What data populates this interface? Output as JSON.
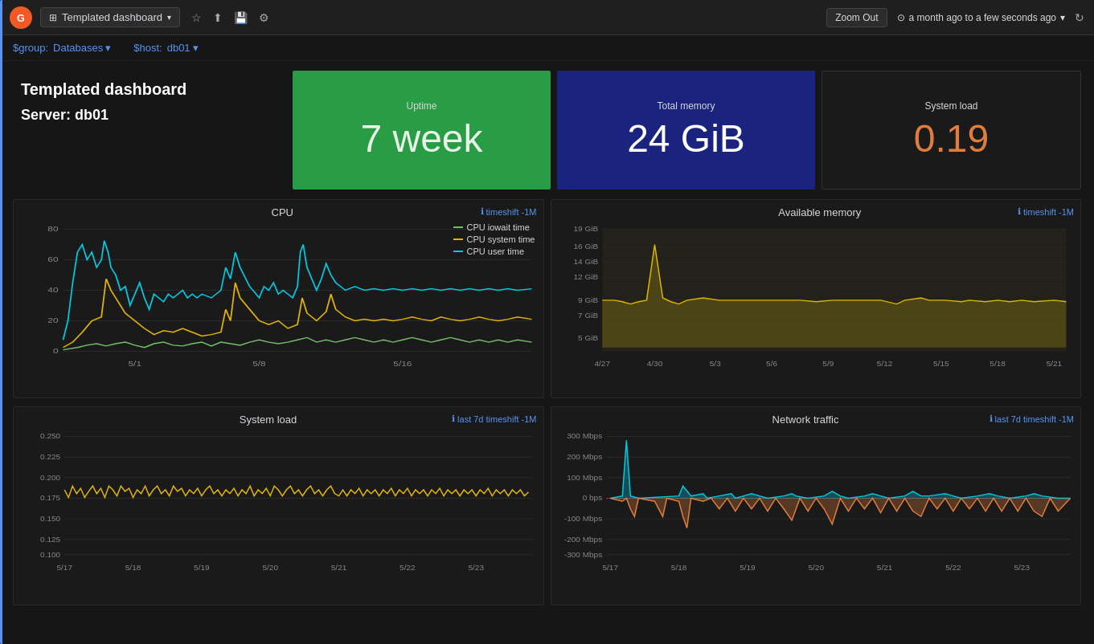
{
  "topbar": {
    "logo_letter": "G",
    "dashboard_label": "Templated dashboard",
    "zoom_out": "Zoom Out",
    "time_range": "a month ago to a few seconds ago",
    "clock_icon": "⊙",
    "refresh_icon": "↻",
    "star_icon": "★",
    "share_icon": "⬆",
    "save_icon": "💾",
    "settings_icon": "⚙"
  },
  "filterbar": {
    "group_label": "$group:",
    "group_value": "Databases",
    "host_label": "$host:",
    "host_value": "db01"
  },
  "title": {
    "dashboard_name": "Templated dashboard",
    "server_name": "Server: db01"
  },
  "uptime": {
    "label": "Uptime",
    "value": "7 week"
  },
  "memory": {
    "label": "Total memory",
    "value": "24 GiB"
  },
  "sysload": {
    "label": "System load",
    "value": "0.19"
  },
  "cpu_chart": {
    "title": "CPU",
    "timeshift": "timeshift -1M",
    "legend": [
      {
        "label": "CPU iowait time",
        "color": "#73bf69"
      },
      {
        "label": "CPU system time",
        "color": "#e0b400"
      },
      {
        "label": "CPU user time",
        "color": "#00c8e0"
      }
    ],
    "y_labels": [
      "80",
      "60",
      "40",
      "20",
      "0"
    ],
    "x_labels": [
      "5/1",
      "5/8",
      "5/16"
    ]
  },
  "memory_chart": {
    "title": "Available memory",
    "timeshift": "timeshift -1M",
    "y_labels": [
      "19 GiB",
      "16 GiB",
      "14 GiB",
      "12 GiB",
      "9 GiB",
      "7 GiB",
      "5 GiB"
    ],
    "x_labels": [
      "4/27",
      "4/30",
      "5/3",
      "5/6",
      "5/9",
      "5/12",
      "5/15",
      "5/18",
      "5/21"
    ]
  },
  "sysload_chart": {
    "title": "System load",
    "timeshift": "last 7d timeshift -1M",
    "y_labels": [
      "0.250",
      "0.225",
      "0.200",
      "0.175",
      "0.150",
      "0.125",
      "0.100"
    ],
    "x_labels": [
      "5/17",
      "5/18",
      "5/19",
      "5/20",
      "5/21",
      "5/22",
      "5/23"
    ]
  },
  "network_chart": {
    "title": "Network traffic",
    "timeshift": "last 7d timeshift -1M",
    "y_labels": [
      "300 Mbps",
      "200 Mbps",
      "100 Mbps",
      "0 bps",
      "-100 Mbps",
      "-200 Mbps",
      "-300 Mbps"
    ],
    "x_labels": [
      "5/17",
      "5/18",
      "5/19",
      "5/20",
      "5/21",
      "5/22",
      "5/23"
    ]
  }
}
